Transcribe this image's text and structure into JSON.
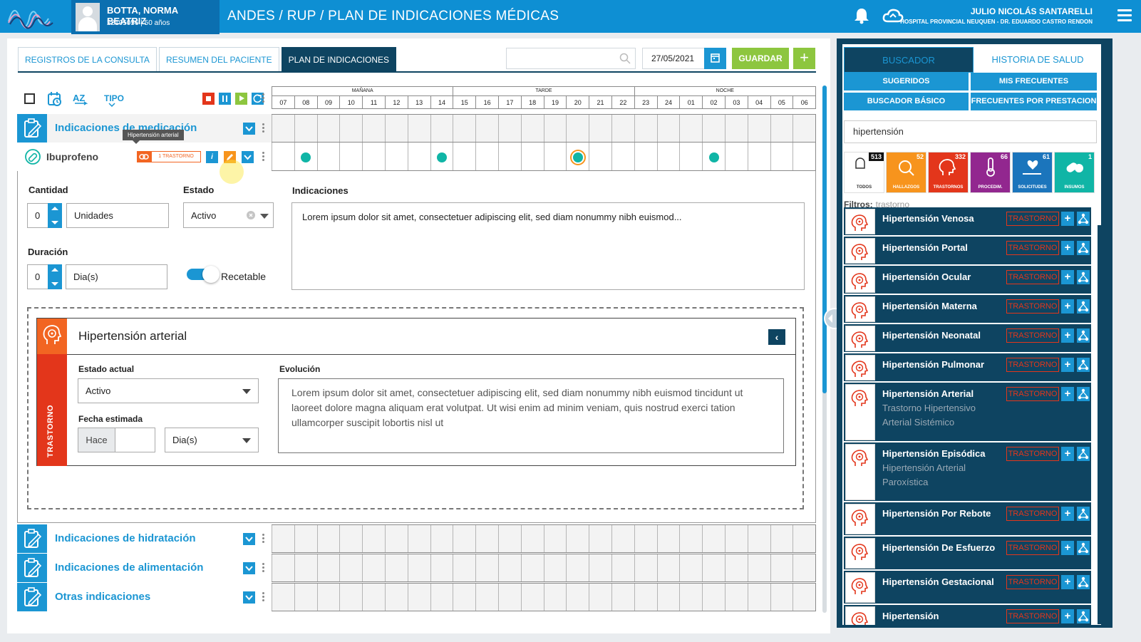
{
  "header": {
    "patient_name": "BOTTA, NORMA BEATRIZ",
    "patient_info": "22105056 | 50 años",
    "app_title": "ANDES / RUP / PLAN DE INDICACIONES MÉDICAS",
    "user_name": "JULIO NICOLÁS SANTARELLI",
    "user_hospital": "HOSPITAL PROVINCIAL NEUQUEN - DR. EDUARDO CASTRO RENDON"
  },
  "tabs": [
    "REGISTROS DE LA CONSULTA",
    "RESUMEN  DEL PACIENTE",
    "PLAN DE INDICACIONES"
  ],
  "toolbar": {
    "search_placeholder": "",
    "date": "27/05/2021",
    "save_label": "GUARDAR",
    "add_label": "+",
    "tipo_label": "TIPO"
  },
  "grid": {
    "sections": [
      "MAÑANA",
      "TARDE",
      "NOCHE"
    ],
    "hours": [
      "07",
      "08",
      "09",
      "10",
      "11",
      "12",
      "13",
      "14",
      "15",
      "16",
      "17",
      "18",
      "19",
      "20",
      "21",
      "22",
      "23",
      "24",
      "01",
      "02",
      "03",
      "04",
      "05",
      "06"
    ]
  },
  "sections": {
    "medicacion": "Indicaciones de medicación",
    "hidratacion": "Indicaciones de hidratación",
    "alimentacion": "Indicaciones de alimentación",
    "otras": "Otras indicaciones"
  },
  "medication": {
    "name": "Ibuprofeno",
    "tooltip": "Hipertensión arterial",
    "trastorno_badge": "1 TRASTORNO",
    "info_label": "i",
    "dose_hours": [
      "08",
      "14",
      "20",
      "02"
    ],
    "current_hour": "20"
  },
  "detail": {
    "cantidad_label": "Cantidad",
    "cantidad_value": "0",
    "unidades": "Unidades",
    "estado_label": "Estado",
    "estado_value": "Activo",
    "duracion_label": "Duración",
    "duracion_value": "0",
    "duracion_unit": "Dia(s)",
    "recetable_label": "Recetable",
    "indicaciones_label": "Indicaciones",
    "indicaciones_text": "Lorem ipsum dolor sit amet, consectetuer adipiscing elit, sed diam nonummy nibh euismod..."
  },
  "trastorno": {
    "side_label": "TRASTORNO",
    "title": "Hipertensión arterial",
    "estado_label": "Estado actual",
    "estado_value": "Activo",
    "fecha_label": "Fecha estimada",
    "hace_label": "Hace",
    "fecha_unit": "Dia(s)",
    "evolucion_label": "Evolución",
    "evolucion_text": "Lorem ipsum dolor sit amet, consectetuer adipiscing elit, sed diam nonummy nibh euismod tincidunt ut laoreet dolore magna aliquam erat volutpat. Ut wisi enim ad minim veniam, quis nostrud exerci tation ullamcorper suscipit lobortis nisl ut"
  },
  "right_panel": {
    "tab_buscador": "BUSCADOR",
    "tab_historia": "HISTORIA DE SALUD",
    "btn_sugeridos": "SUGERIDOS",
    "btn_frecuentes": "MIS FRECUENTES",
    "btn_basico": "BUSCADOR BÁSICO",
    "btn_prestacion": "FRECUENTES POR PRESTACION",
    "search_value": "hipertensión",
    "categories": [
      {
        "label": "TODOS",
        "count": "513",
        "color": "#ffffff",
        "count_bg": "#111111"
      },
      {
        "label": "HALLAZGOS",
        "count": "52",
        "color": "#f7941d",
        "count_bg": "#f7941d"
      },
      {
        "label": "TRASTORNOS",
        "count": "332",
        "color": "#e3361b",
        "count_bg": "#e3361b"
      },
      {
        "label": "PROCEDIM.",
        "count": "66",
        "color": "#92278f",
        "count_bg": "#92278f"
      },
      {
        "label": "SOLICITUDES",
        "count": "61",
        "color": "#1b75bc",
        "count_bg": "#1b75bc"
      },
      {
        "label": "INSUMOS",
        "count": "1",
        "color": "#10b5a6",
        "count_bg": "#10b5a6"
      }
    ],
    "filtros_label": "Filtros:",
    "filtros_value": "trastorno",
    "tag_label": "TRASTORNO",
    "results": [
      {
        "name": "Hipertensión Venosa",
        "sub": ""
      },
      {
        "name": "Hipertensión Portal",
        "sub": ""
      },
      {
        "name": "Hipertensión Ocular",
        "sub": ""
      },
      {
        "name": "Hipertensión Materna",
        "sub": ""
      },
      {
        "name": "Hipertensión Neonatal",
        "sub": ""
      },
      {
        "name": "Hipertensión Pulmonar",
        "sub": ""
      },
      {
        "name": "Hipertensión Arterial",
        "sub": "Trastorno Hipertensivo Arterial Sistémico"
      },
      {
        "name": "Hipertensión Episódica",
        "sub": "Hipertensión Arterial Paroxística"
      },
      {
        "name": "Hipertensión Por Rebote",
        "sub": ""
      },
      {
        "name": "Hipertensión De Esfuerzo",
        "sub": ""
      },
      {
        "name": "Hipertensión Gestacional",
        "sub": ""
      },
      {
        "name": "Hipertensión",
        "sub": ""
      }
    ]
  }
}
